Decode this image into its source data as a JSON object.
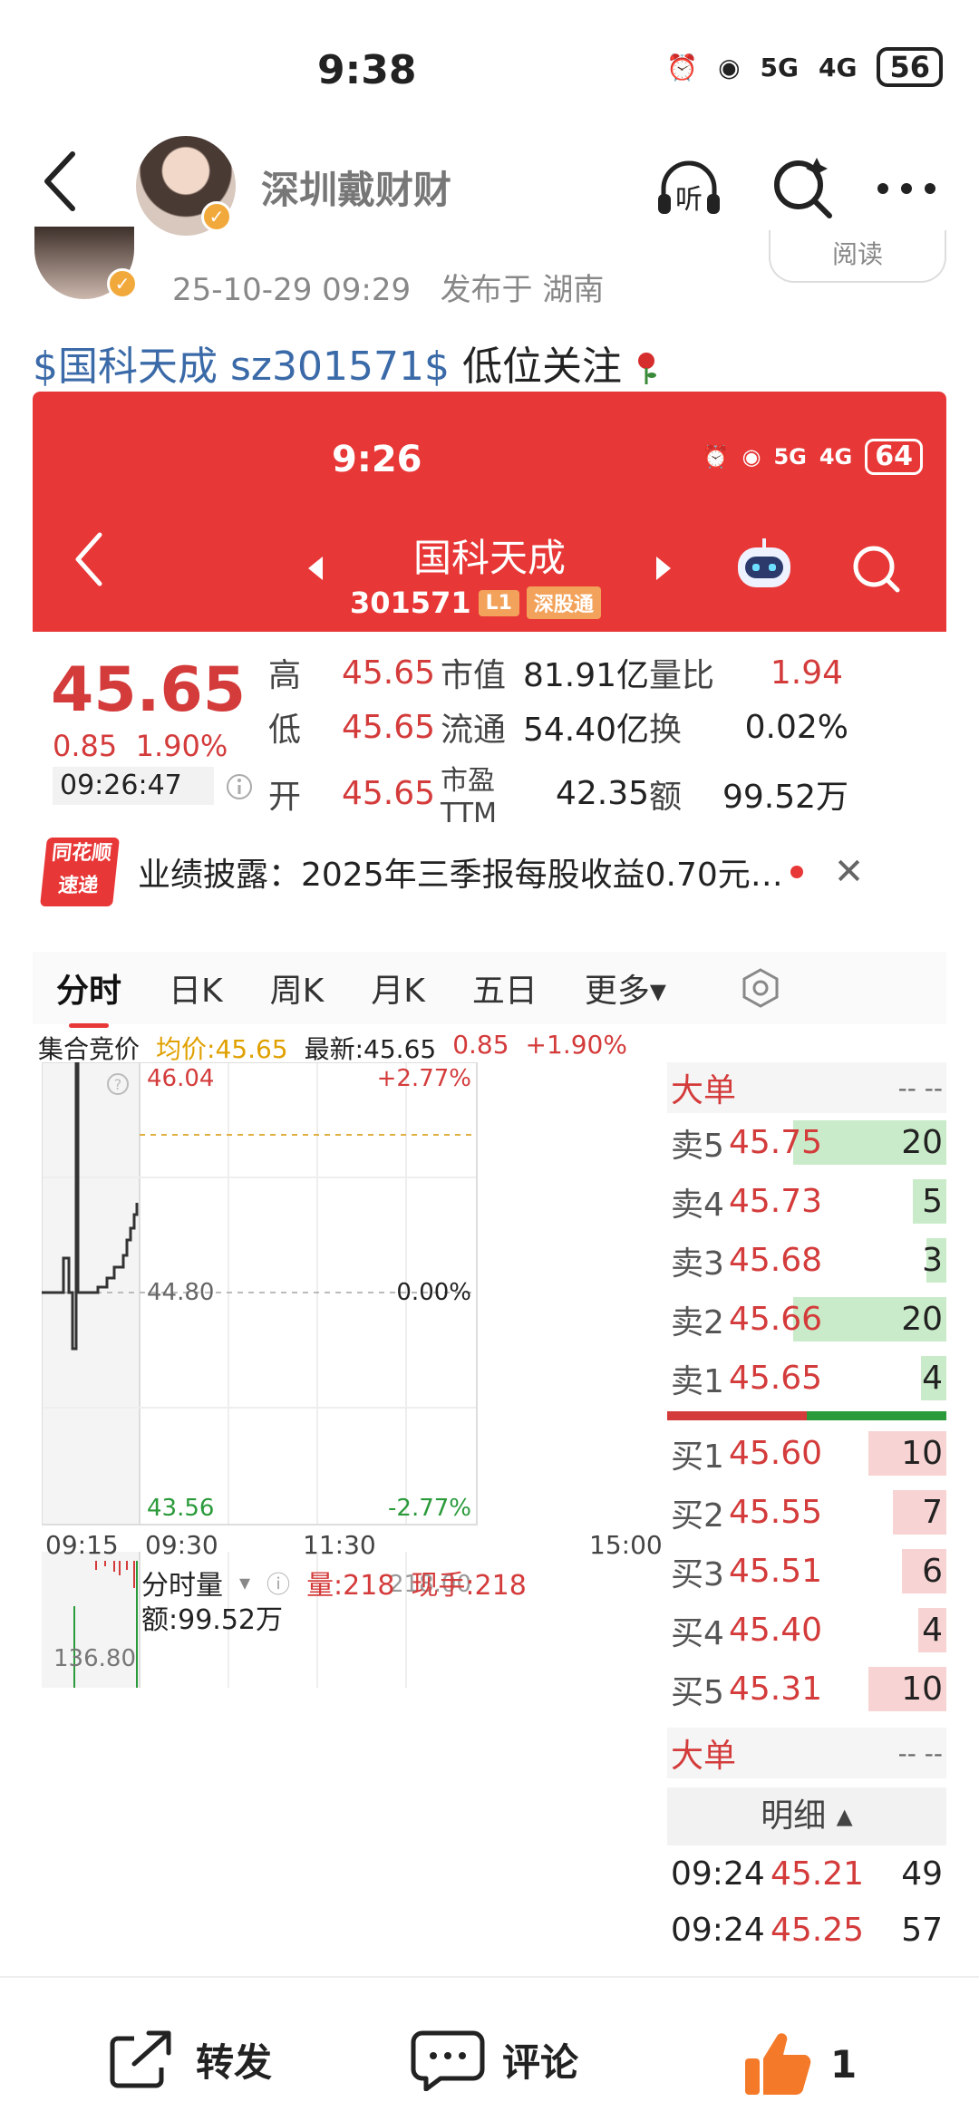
{
  "status_bar": {
    "time": "9:38",
    "net1": "5G",
    "net2": "4G",
    "battery": "56"
  },
  "header": {
    "username": "深圳戴财财",
    "listen_label": "听"
  },
  "post_meta": {
    "datetime": "25-10-29 09:29",
    "location": "发布于 湖南",
    "read_label": "阅读"
  },
  "post": {
    "tag": "$国科天成 sz301571$",
    "text": " 低位关注"
  },
  "stock_app": {
    "status_time": "9:26",
    "battery": "64",
    "net1": "5G",
    "net2": "4G",
    "stock_name": "国科天成",
    "stock_code": "301571",
    "badge_l1": "L1",
    "badge_sgt": "深股通",
    "price": "45.65",
    "change": "0.85",
    "change_pct": "1.90%",
    "quote_time": "09:26:47",
    "quote_rows": [
      {
        "l1": "高",
        "v1": "45.65",
        "l2": "市值",
        "v2": "81.91亿",
        "l3": "量比",
        "v3": "1.94"
      },
      {
        "l1": "低",
        "v1": "45.65",
        "l2": "流通",
        "v2": "54.40亿",
        "l3": "换",
        "v3": "0.02%"
      },
      {
        "l1": "开",
        "v1": "45.65",
        "l2": "市盈TTM",
        "v2": "42.35",
        "l3": "额",
        "v3": "99.52万"
      }
    ],
    "news_logo_top": "同花顺",
    "news_logo_bottom": "速递",
    "news": "业绩披露：2025年三季报每股收益0.70元…",
    "tabs": [
      "分时",
      "日K",
      "周K",
      "月K",
      "五日",
      "更多▾"
    ],
    "info": {
      "mode": "集合竞价",
      "avg": "均价:45.65",
      "latest": "最新:45.65",
      "chg": "0.85",
      "pct": "+1.90%"
    },
    "chart": {
      "y_top": "46.04",
      "y_mid": "44.80",
      "y_bot": "43.56",
      "pct_top": "+2.77%",
      "pct_mid": "0.00%",
      "pct_bot": "-2.77%",
      "x_labels": [
        "09:15",
        "09:30",
        "11:30",
        "15:00"
      ]
    },
    "volume": {
      "mode": "分时量",
      "vol": "量:218",
      "cur": "现手:218",
      "cur_val": "218.00",
      "amount": "额:99.52万",
      "axis": "136.80"
    },
    "order_book": {
      "big_label": "大单",
      "dash": "-- --",
      "asks": [
        {
          "label": "卖5",
          "price": "45.75",
          "qty": "20",
          "level": 0.55
        },
        {
          "label": "卖4",
          "price": "45.73",
          "qty": "5",
          "level": 0.12
        },
        {
          "label": "卖3",
          "price": "45.68",
          "qty": "3",
          "level": 0.07
        },
        {
          "label": "卖2",
          "price": "45.66",
          "qty": "20",
          "level": 0.55
        },
        {
          "label": "卖1",
          "price": "45.65",
          "qty": "4",
          "level": 0.09
        }
      ],
      "bids": [
        {
          "label": "买1",
          "price": "45.60",
          "qty": "10",
          "level": 0.28
        },
        {
          "label": "买2",
          "price": "45.55",
          "qty": "7",
          "level": 0.19
        },
        {
          "label": "买3",
          "price": "45.51",
          "qty": "6",
          "level": 0.16
        },
        {
          "label": "买4",
          "price": "45.40",
          "qty": "4",
          "level": 0.1
        },
        {
          "label": "买5",
          "price": "45.31",
          "qty": "10",
          "level": 0.28
        }
      ],
      "detail_label": "明细 ▴",
      "details": [
        {
          "time": "09:24",
          "price": "45.21",
          "qty": "49"
        },
        {
          "time": "09:24",
          "price": "45.25",
          "qty": "57"
        }
      ]
    }
  },
  "bottom_bar": {
    "forward": "转发",
    "comment": "评论",
    "likes": "1"
  }
}
